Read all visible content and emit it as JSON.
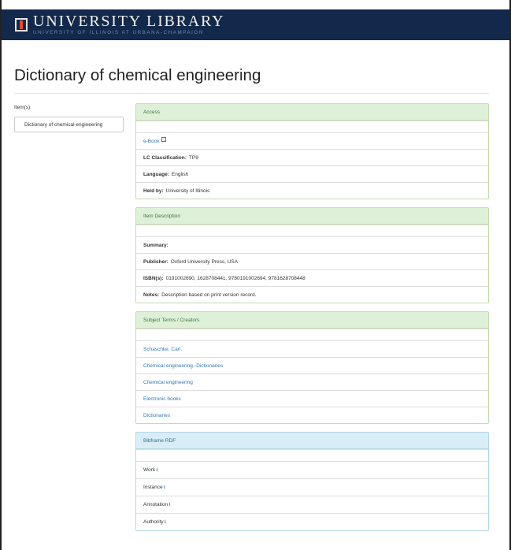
{
  "header": {
    "title": "UNIVERSITY LIBRARY",
    "subtitle": "UNIVERSITY OF ILLINOIS AT URBANA-CHAMPAIGN",
    "logo_icon": "illinois-block-i-icon"
  },
  "page_title": "Dictionary of chemical engineering",
  "items": {
    "label": "Item(s)",
    "entries": [
      "Dictionary of chemical engineering"
    ]
  },
  "access": {
    "heading": "Access",
    "ebook_link": "e-Book",
    "ebook_icon": "external-link-icon",
    "lc_label": "LC Classification:",
    "lc_value": "TP9",
    "language_label": "Language:",
    "language_value": "English",
    "held_label": "Held by:",
    "held_value": "University of Illinois"
  },
  "description": {
    "heading": "Item Description",
    "summary_label": "Summary:",
    "summary_value": "",
    "publisher_label": "Publisher:",
    "publisher_value": "Oxford University Press, USA",
    "isbn_label": "ISBN(s):",
    "isbn_value": "0191002690, 1628708441, 9780191002694, 9781628708448",
    "notes_label": "Notes:",
    "notes_value": "Description based on print version record."
  },
  "subjects": {
    "heading": "Subject Terms / Creators",
    "links": [
      "Schaschke, Carl.",
      "Chemical engineering--Dictionaries",
      "Chemical engineering",
      "Electronic books",
      "Dictionaries"
    ]
  },
  "bibframe": {
    "heading": "Bibframe RDF",
    "download_icon": "download-icon",
    "links": [
      "Work",
      "Instance",
      "Annotation",
      "Authority"
    ]
  },
  "colors": {
    "header_bg": "#13294b",
    "logo_accent": "#e84a27",
    "link": "#337ab7",
    "panel_green": "#dff0d8",
    "panel_blue": "#d9edf7"
  }
}
